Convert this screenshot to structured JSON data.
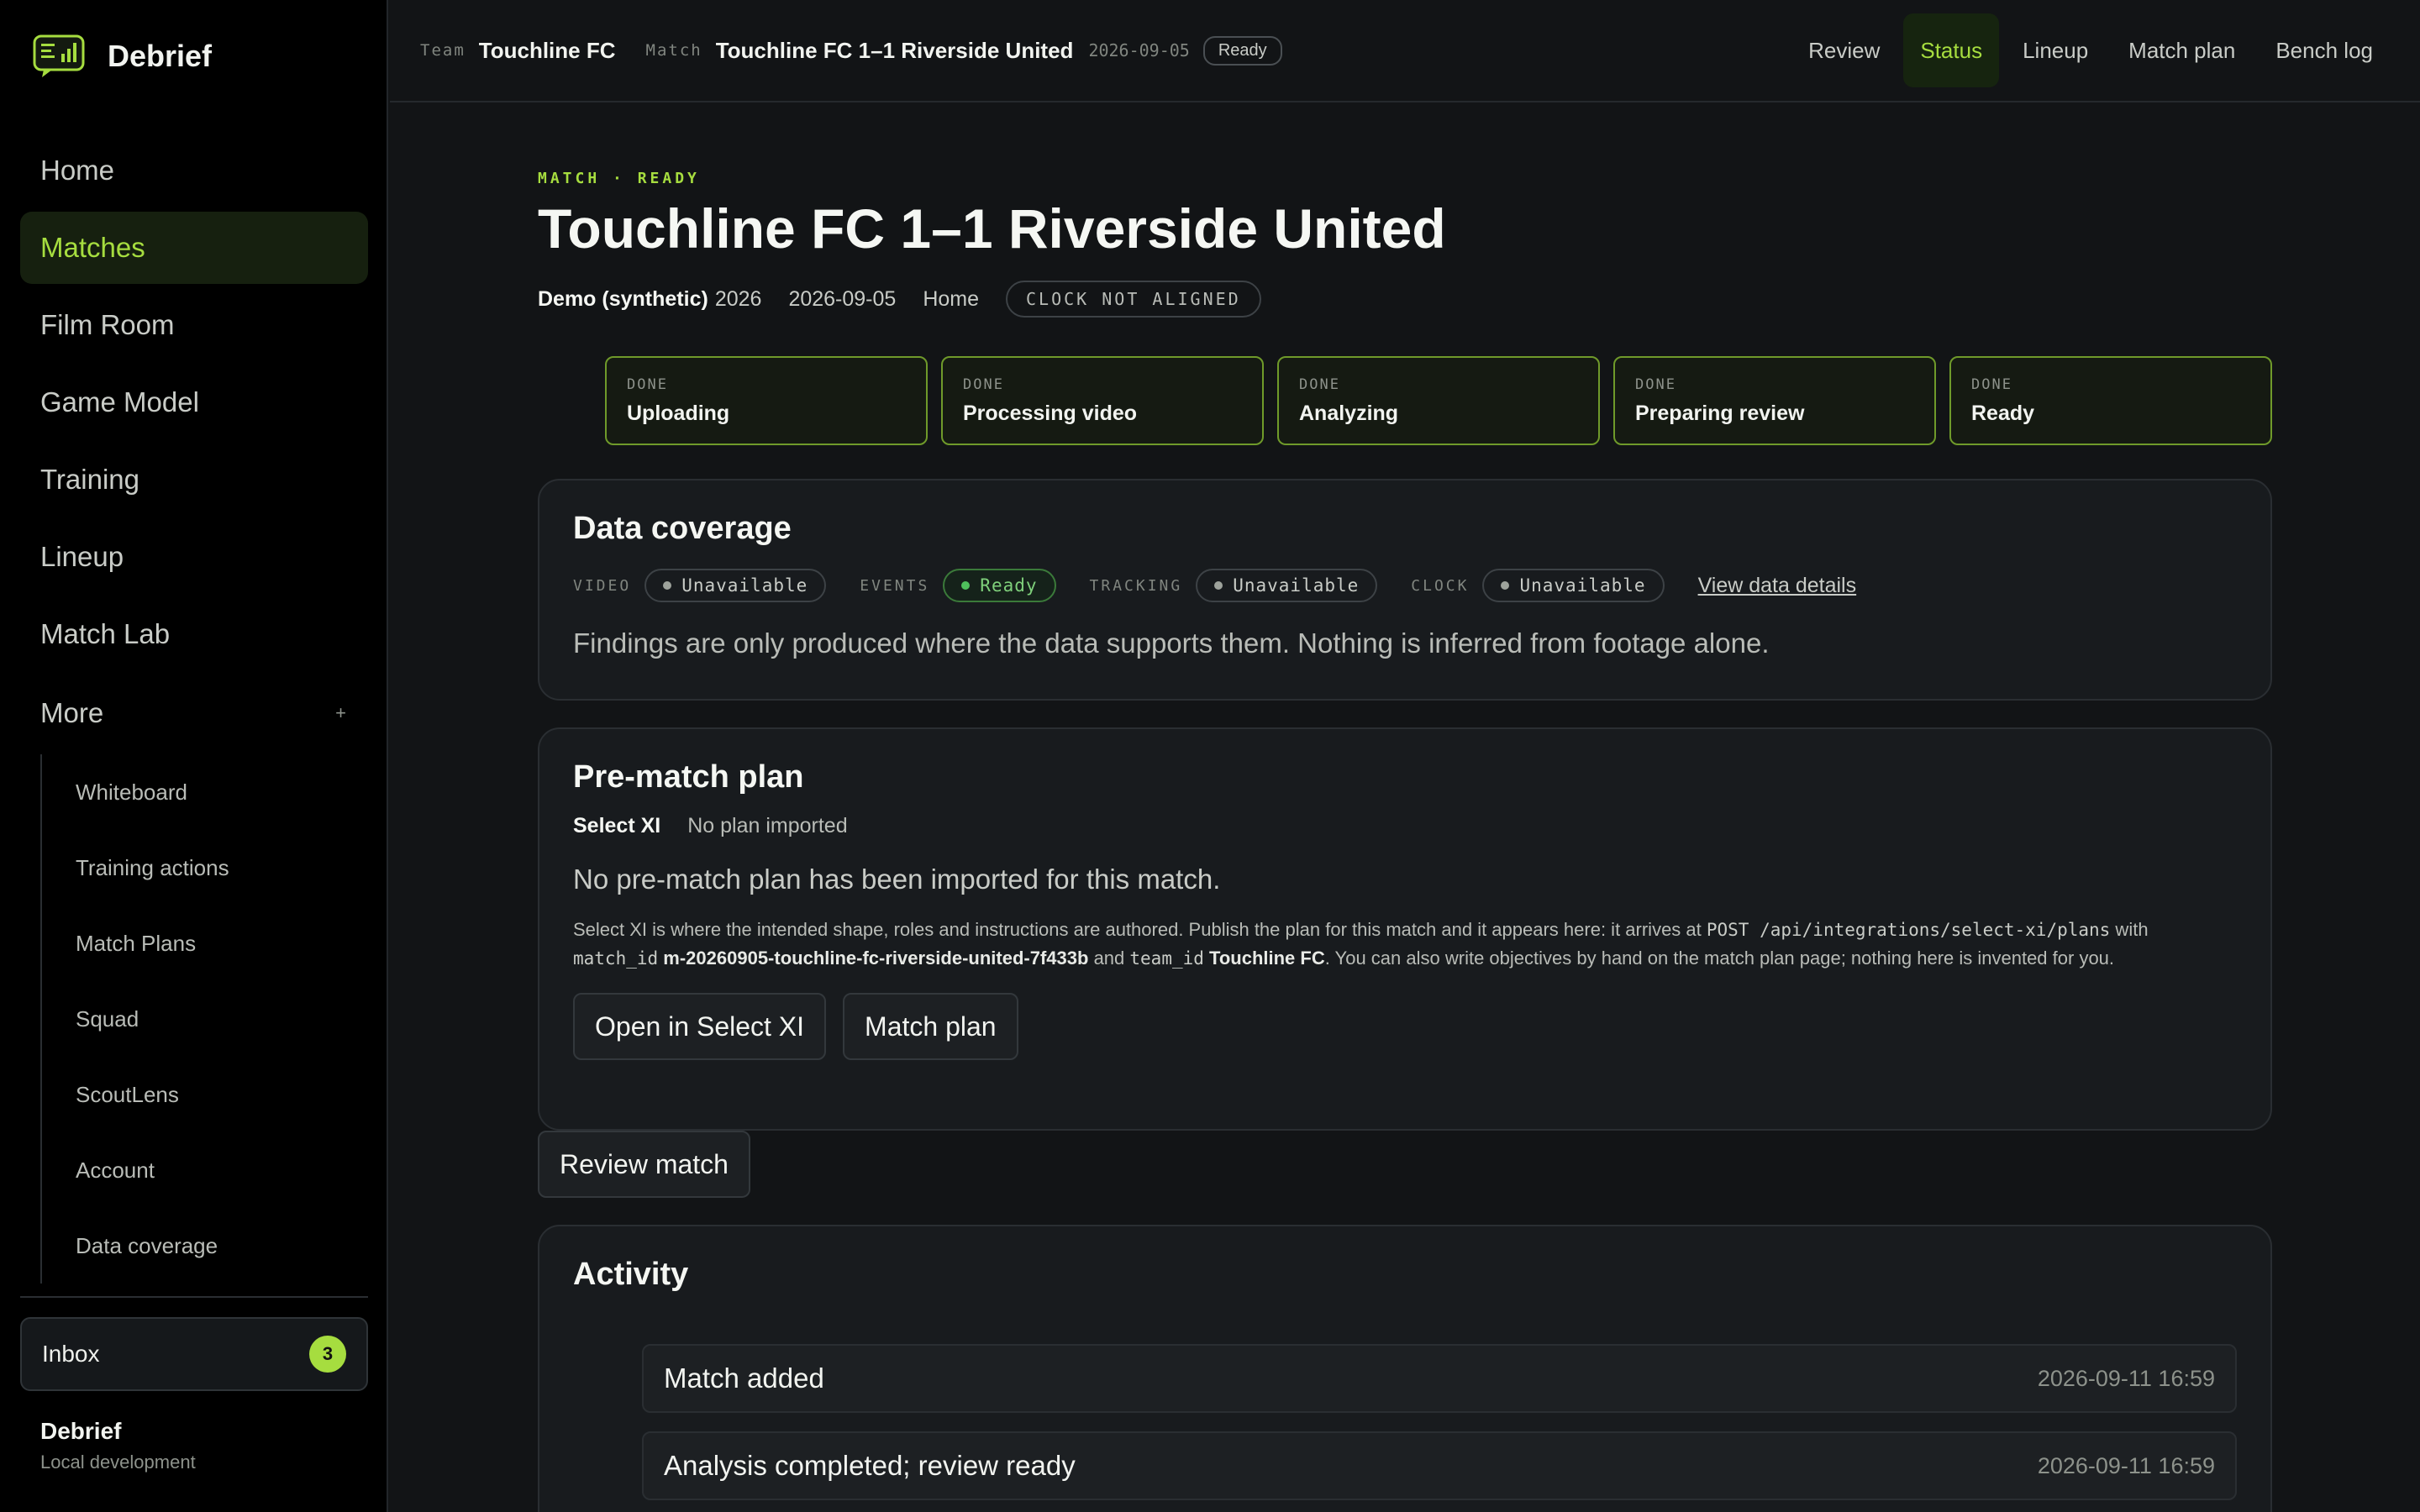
{
  "app": {
    "name": "Debrief",
    "footer_title": "Debrief",
    "footer_subtitle": "Local development"
  },
  "colors": {
    "accent": "#a6dd3f",
    "background": "#121416",
    "sidebar": "#000000",
    "ready": "#4fc05c"
  },
  "sidebar": {
    "items": [
      {
        "label": "Home"
      },
      {
        "label": "Matches",
        "active": true
      },
      {
        "label": "Film Room"
      },
      {
        "label": "Game Model"
      },
      {
        "label": "Training"
      },
      {
        "label": "Lineup"
      },
      {
        "label": "Match Lab"
      }
    ],
    "more_label": "More",
    "more_toggle": "+",
    "sub_items": [
      {
        "label": "Whiteboard"
      },
      {
        "label": "Training actions"
      },
      {
        "label": "Match Plans"
      },
      {
        "label": "Squad"
      },
      {
        "label": "ScoutLens"
      },
      {
        "label": "Account"
      },
      {
        "label": "Data coverage"
      }
    ],
    "inbox_label": "Inbox",
    "inbox_count": "3"
  },
  "topbar": {
    "team_label": "Team",
    "team_value": "Touchline FC",
    "match_label": "Match",
    "match_value": "Touchline FC 1–1 Riverside United",
    "match_date": "2026-09-05",
    "match_status": "Ready",
    "tabs": [
      {
        "label": "Review"
      },
      {
        "label": "Status",
        "active": true
      },
      {
        "label": "Lineup"
      },
      {
        "label": "Match plan"
      },
      {
        "label": "Bench log"
      }
    ]
  },
  "page": {
    "eyebrow": "MATCH · READY",
    "title": "Touchline FC 1–1 Riverside United",
    "season_bold": "Demo (synthetic)",
    "season_year": "2026",
    "date": "2026-09-05",
    "venue": "Home",
    "clock_badge": "CLOCK NOT ALIGNED"
  },
  "steps": [
    {
      "status": "DONE",
      "name": "Uploading"
    },
    {
      "status": "DONE",
      "name": "Processing video"
    },
    {
      "status": "DONE",
      "name": "Analyzing"
    },
    {
      "status": "DONE",
      "name": "Preparing review"
    },
    {
      "status": "DONE",
      "name": "Ready"
    }
  ],
  "coverage": {
    "title": "Data coverage",
    "items": [
      {
        "label": "VIDEO",
        "value": "Unavailable"
      },
      {
        "label": "EVENTS",
        "value": "Ready"
      },
      {
        "label": "TRACKING",
        "value": "Unavailable"
      },
      {
        "label": "CLOCK",
        "value": "Unavailable"
      }
    ],
    "link": "View data details",
    "note": "Findings are only produced where the data supports them. Nothing is inferred from footage alone."
  },
  "plan": {
    "title": "Pre-match plan",
    "source": "Select XI",
    "source_status": "No plan imported",
    "empty": "No pre-match plan has been imported for this match.",
    "desc_1": "Select XI is where the intended shape, roles and instructions are authored. Publish the plan for this match and it appears here: it arrives at ",
    "endpoint": "POST /api/integrations/select-xi/plans",
    "desc_2": " with ",
    "match_key": "match_id",
    "match_id": "m-20260905-touchline-fc-riverside-united-7f433b",
    "desc_3": " and ",
    "team_key": "team_id",
    "team_id": "Touchline FC",
    "desc_4": ". You can also write objectives by hand on the match plan page; nothing here is invented for you.",
    "btn_open": "Open in Select XI",
    "btn_plan": "Match plan"
  },
  "review_button": "Review match",
  "activity": {
    "title": "Activity",
    "items": [
      {
        "text": "Match added",
        "time": "2026-09-11 16:59"
      },
      {
        "text": "Analysis completed; review ready",
        "time": "2026-09-11 16:59"
      }
    ]
  }
}
